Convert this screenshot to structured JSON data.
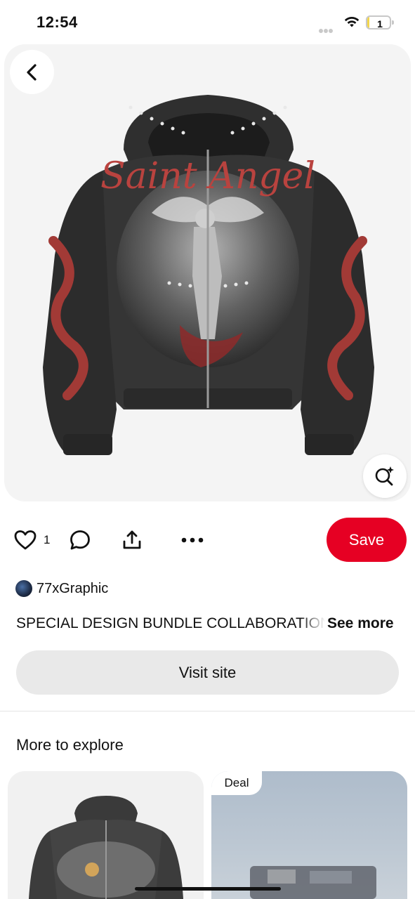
{
  "status_bar": {
    "time": "12:54",
    "battery_level": "1",
    "battery_fraction": 0.1,
    "battery_color": "#f3d64a"
  },
  "pin": {
    "image_icon": "hooded-zip-jacket-image",
    "print_text": "Saint Angel",
    "back_icon": "chevron-left-icon",
    "visual_search_icon": "magnify-sparkle-icon"
  },
  "actions": {
    "like_icon": "heart-icon",
    "like_count": "1",
    "comment_icon": "comment-bubble-icon",
    "share_icon": "share-upload-icon",
    "more_icon": "ellipsis-icon",
    "save_label": "Save",
    "save_color": "#e60023"
  },
  "creator": {
    "name": "77xGraphic"
  },
  "description": {
    "text": "SPECIAL DESIGN BUNDLE COLLABORATION",
    "see_more_label": "See more"
  },
  "visit_site_label": "Visit site",
  "more_to_explore": {
    "title": "More to explore",
    "cards": [
      {
        "badge": "",
        "image_icon": "graphic-hoodie-image"
      },
      {
        "badge": "Deal",
        "image_icon": "blurred-product-image"
      }
    ]
  }
}
